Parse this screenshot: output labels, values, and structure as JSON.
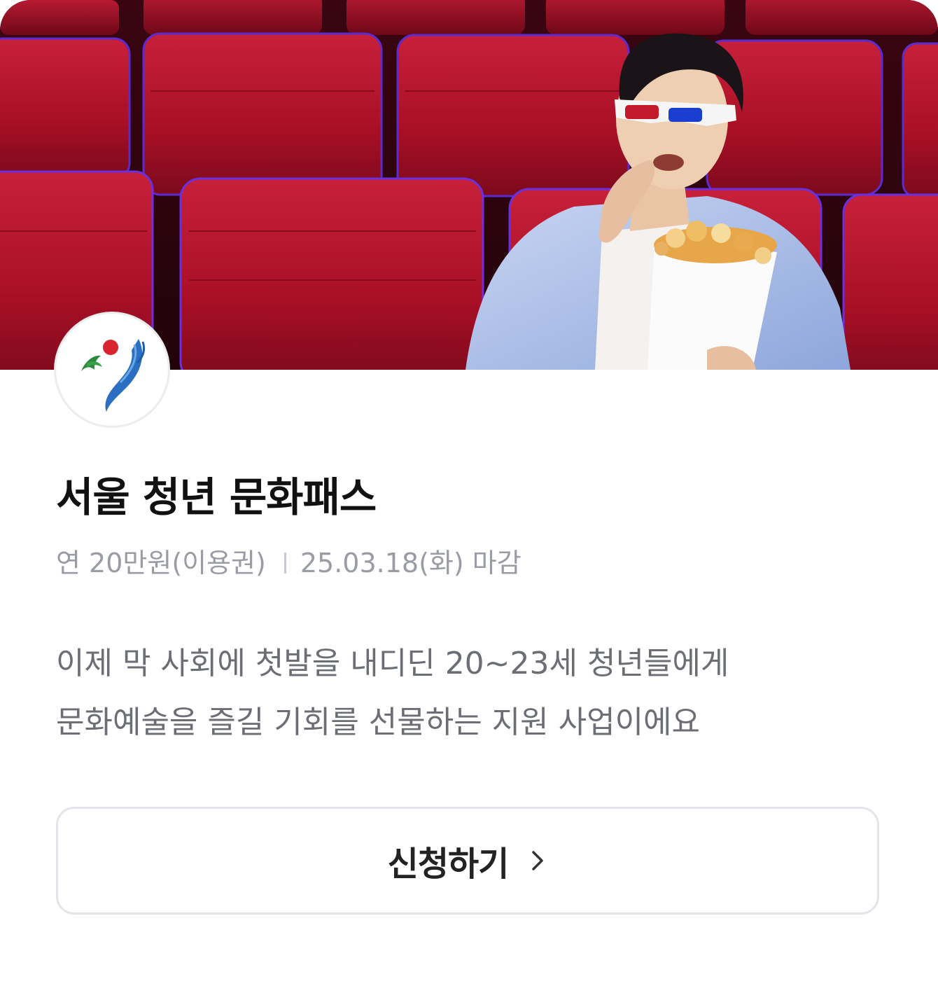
{
  "program": {
    "title": "서울 청년 문화패스",
    "benefit": "연 20만원(이용권)",
    "deadline": "25.03.18(화) 마감",
    "description_lines": [
      "이제 막 사회에 첫발을 내디딘 20~23세 청년들에게",
      "문화예술을 즐길 기회를 선물하는 지원 사업이에요"
    ]
  },
  "hero": {
    "icon": "cinema-photo"
  },
  "logo": {
    "icon": "seoul-symbol-icon"
  },
  "apply_button": {
    "label": "신청하기",
    "icon": "chevron-right-icon"
  },
  "colors": {
    "title": "#111111",
    "meta": "#9a9ca5",
    "description": "#6c6e76",
    "button_border": "#e3e4ea",
    "seat_red": "#b4142c"
  }
}
